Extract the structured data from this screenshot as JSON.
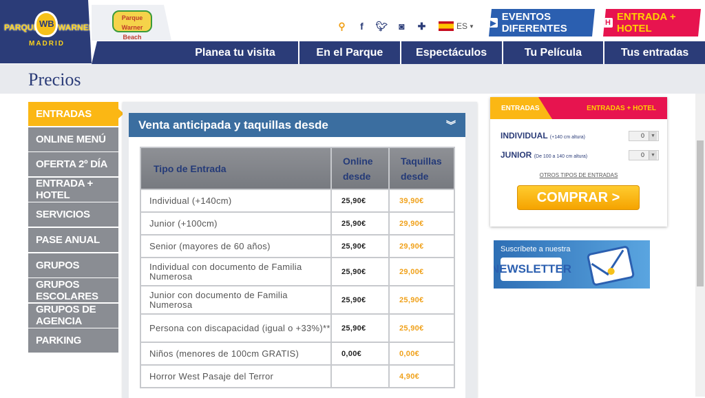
{
  "brand": {
    "logo_text_left": "PARQUE",
    "logo_text_center": "WB",
    "logo_text_right": "WARNER",
    "logo_city": "MADRID",
    "sublogo_text": "Parque Warner Beach"
  },
  "utility": {
    "icons": [
      "search-icon",
      "facebook-icon",
      "twitter-icon",
      "instagram-icon",
      "plus-icon"
    ],
    "language": "ES"
  },
  "cta": {
    "eventos": "EVENTOS DIFERENTES",
    "hotel": "ENTRADA + HOTEL"
  },
  "nav": [
    "Planea tu visita",
    "En el Parque",
    "Espectáculos",
    "Tu Película",
    "Tus entradas"
  ],
  "page": {
    "title": "Precios"
  },
  "sidebar": {
    "items": [
      {
        "label": "ENTRADAS",
        "active": true
      },
      {
        "label": "ONLINE MENÚ",
        "active": false
      },
      {
        "label": "OFERTA 2º DÍA",
        "active": false
      },
      {
        "label": "ENTRADA + HOTEL",
        "active": false
      },
      {
        "label": "SERVICIOS",
        "active": false
      },
      {
        "label": "PASE ANUAL",
        "active": false
      },
      {
        "label": "GRUPOS",
        "active": false
      },
      {
        "label": "GRUPOS ESCOLARES",
        "active": false
      },
      {
        "label": "GRUPOS DE AGENCIA",
        "active": false
      },
      {
        "label": "PARKING",
        "active": false
      }
    ]
  },
  "prices": {
    "heading": "Venta anticipada y taquillas desde",
    "columns": [
      "Tipo de Entrada",
      "Online desde",
      "Taquillas desde"
    ],
    "rows": [
      {
        "tipo": "Individual (+140cm)",
        "online": "25,90€",
        "taquilla": "39,90€"
      },
      {
        "tipo": "Junior (+100cm)",
        "online": "25,90€",
        "taquilla": "29,90€"
      },
      {
        "tipo": "Senior (mayores de 60 años)",
        "online": "25,90€",
        "taquilla": "29,90€"
      },
      {
        "tipo": "Individual con documento de Familia Numerosa",
        "online": "25,90€",
        "taquilla": "29,00€"
      },
      {
        "tipo": "Junior con documento de Familia Numerosa",
        "online": "25,90€",
        "taquilla": "25,90€"
      },
      {
        "tipo": "Persona con discapacidad (igual o +33%)**",
        "online": "25,90€",
        "taquilla": "25,90€"
      },
      {
        "tipo": "Niños (menores de 100cm GRATIS)",
        "online": "0,00€",
        "taquilla": "0,00€"
      },
      {
        "tipo": "Horror West Pasaje del Terror",
        "online": "",
        "taquilla": "4,90€"
      }
    ]
  },
  "ticketbox": {
    "tab_entradas": "ENTRADAS",
    "tab_hotel": "ENTRADAS + HOTEL",
    "individual_label": "INDIVIDUAL",
    "individual_note": "(+140 cm altura)",
    "individual_qty": "0",
    "junior_label": "JUNIOR",
    "junior_note": "(De 100 a 140 cm altura)",
    "junior_qty": "0",
    "otros": "OTROS TIPOS DE ENTRADAS",
    "comprar": "COMPRAR >"
  },
  "newsletter": {
    "subtitle": "Suscríbete a nuestra",
    "button": "NEWSLETTER"
  }
}
